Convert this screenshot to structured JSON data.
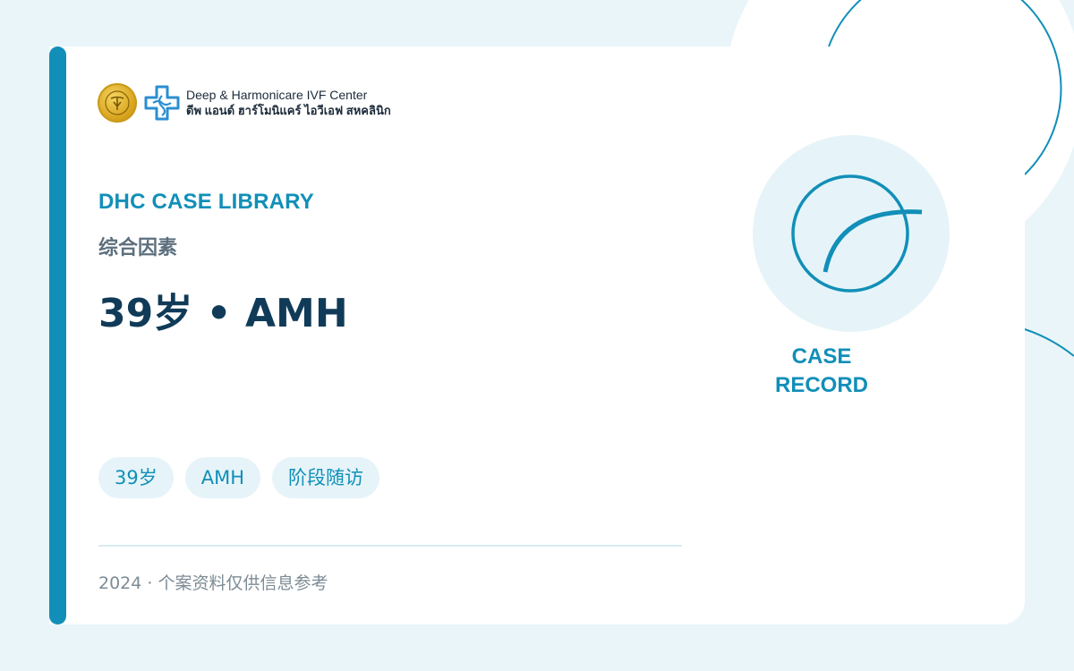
{
  "brand": {
    "name_en": "Deep & Harmonicare IVF Center",
    "name_th": "ดีพ แอนด์ ฮาร์โมนิแคร์ ไอวีเอฟ สหคลินิก",
    "seal_icon": "gold-seal-icon",
    "logo_icon": "blue-cross-logo-icon"
  },
  "content": {
    "library": "DHC CASE LIBRARY",
    "factor": "综合因素",
    "title": "39岁 • AMH",
    "tags": [
      "39岁",
      "AMH",
      "阶段随访"
    ],
    "footer": "2024 · 个案资料仅供信息参考"
  },
  "badge": {
    "line1": "CASE",
    "line2": "RECORD",
    "icon": "circle-arc-icon"
  },
  "colors": {
    "accent": "#118fb8",
    "title": "#103b58",
    "background": "#e9f5f9",
    "card": "#ffffff",
    "tag_bg": "#e6f4f9",
    "seal_gold": "#d9a520"
  }
}
